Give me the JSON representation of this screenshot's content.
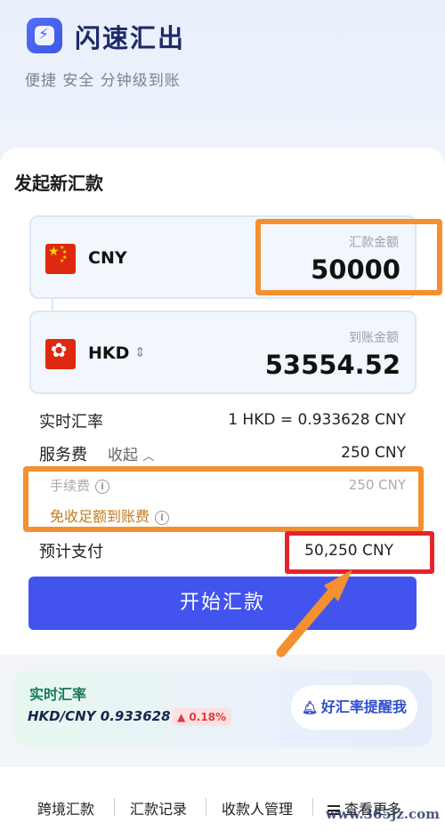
{
  "header": {
    "app_title": "闪速汇出",
    "subtitle": "便捷 安全 分钟级到账"
  },
  "remit": {
    "section_title": "发起新汇款",
    "from": {
      "currency": "CNY",
      "label": "汇款金额",
      "amount": "50000",
      "flag": "cn-flag-icon"
    },
    "to": {
      "currency": "HKD",
      "label": "到账金额",
      "amount": "53554.52",
      "flag": "hk-flag-icon"
    },
    "rate_label": "实时汇率",
    "rate_value": "1 HKD = 0.933628 CNY",
    "service_fee_label": "服务费",
    "collapse_label": "收起",
    "service_fee_value": "250 CNY",
    "handling_fee_label": "手续费",
    "handling_fee_value": "250 CNY",
    "waive_label": "免收足额到账费",
    "total_label": "预计支付",
    "total_value": "50,250 CNY",
    "submit_label": "开始汇款"
  },
  "rate_banner": {
    "title": "实时汇率",
    "pair": "HKD/CNY 0.933628",
    "change": "▲ 0.18%",
    "alert_label": "好汇率提醒我"
  },
  "bottom_nav": {
    "items": [
      "跨境汇款",
      "汇款记录",
      "收款人管理",
      "查看更多"
    ]
  },
  "watermark": "www.365jz.com",
  "colors": {
    "primary": "#4253ee",
    "highlight_orange": "#f4902f",
    "highlight_red": "#e5232c",
    "rate_green": "#1a7a55",
    "rate_up_red": "#e23b3b"
  }
}
